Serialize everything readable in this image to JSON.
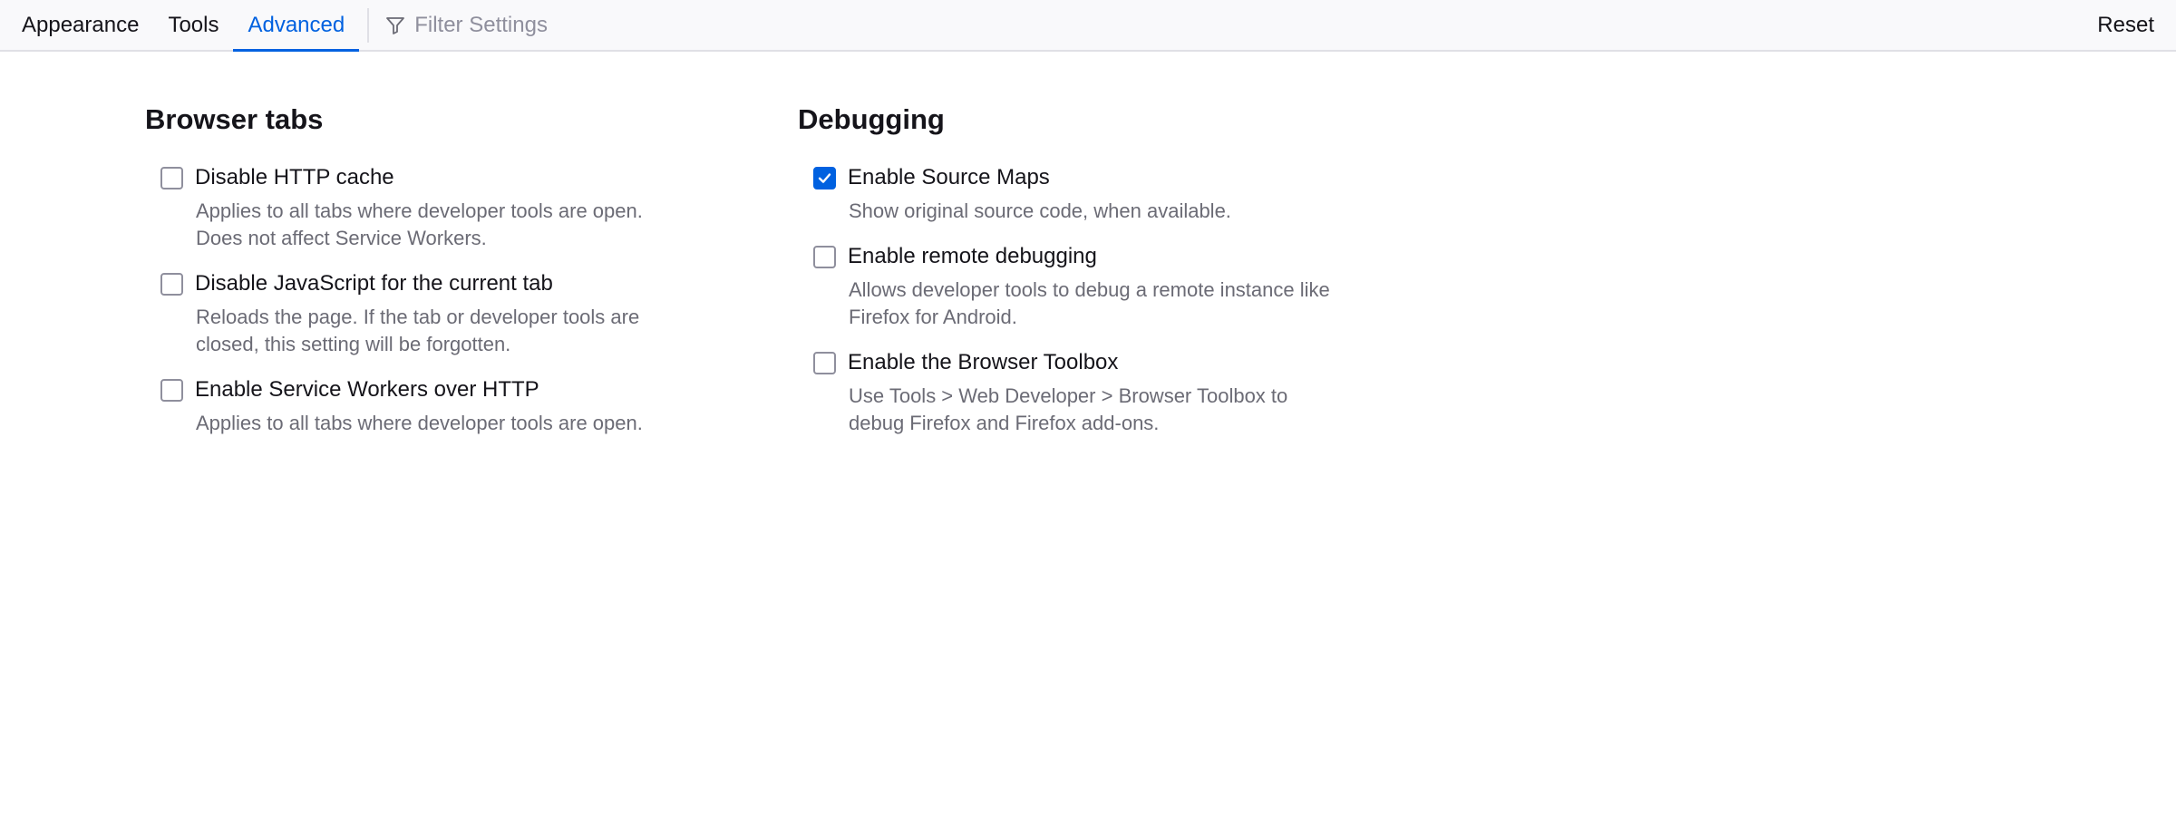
{
  "toolbar": {
    "tabs": [
      {
        "label": "Appearance"
      },
      {
        "label": "Tools"
      },
      {
        "label": "Advanced"
      }
    ],
    "filter_placeholder": "Filter Settings",
    "filter_icon": "filter-icon",
    "reset_label": "Reset"
  },
  "sections": {
    "browser_tabs": {
      "title": "Browser tabs",
      "options": [
        {
          "label": "Disable HTTP cache",
          "checked": false,
          "desc_lines": [
            "Applies to all tabs where developer tools are open.",
            "Does not affect Service Workers."
          ]
        },
        {
          "label": "Disable JavaScript for the current tab",
          "checked": false,
          "desc_lines": [
            "Reloads the page. If the tab or developer tools are",
            "closed, this setting will be forgotten."
          ]
        },
        {
          "label": "Enable Service Workers over HTTP",
          "checked": false,
          "desc_lines": [
            "Applies to all tabs where developer tools are open."
          ]
        }
      ]
    },
    "debugging": {
      "title": "Debugging",
      "options": [
        {
          "label": "Enable Source Maps",
          "checked": true,
          "desc_lines": [
            "Show original source code, when available."
          ]
        },
        {
          "label": "Enable remote debugging",
          "checked": false,
          "desc_lines": [
            "Allows developer tools to debug a remote instance like",
            "Firefox for Android."
          ]
        },
        {
          "label": "Enable the Browser Toolbox",
          "checked": false,
          "desc_lines": [
            "Use Tools > Web Developer > Browser Toolbox to",
            "debug Firefox and Firefox add-ons."
          ]
        }
      ]
    }
  },
  "colors": {
    "accent": "#0061e0",
    "toolbar_bg": "#f9f9fb",
    "description_text": "#6b6b75"
  }
}
